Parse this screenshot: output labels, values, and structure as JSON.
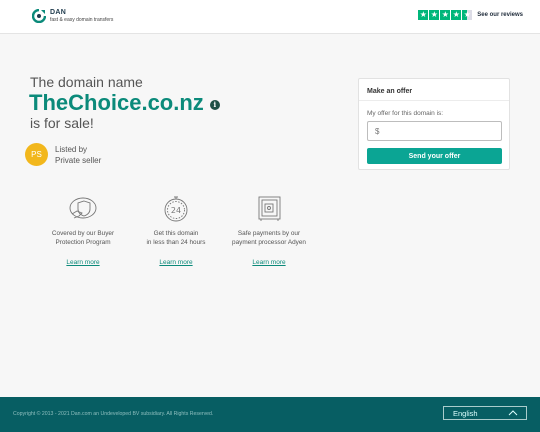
{
  "header": {
    "brand_name": "DAN",
    "brand_tagline": "fast & easy domain transfers",
    "reviews_link": "See our reviews",
    "rating_stars": 4.5,
    "brand_color": "#0b8a7a"
  },
  "main": {
    "lead": "The domain name",
    "domain": "TheChoice.co.nz",
    "forsale": "is for sale!",
    "seller": {
      "initials": "PS",
      "listed_by": "Listed by",
      "name": "Private seller"
    },
    "features": [
      {
        "icon": "shield-hand-icon",
        "line1": "Covered by our Buyer",
        "line2": "Protection Program",
        "link": "Learn more"
      },
      {
        "icon": "clock-24-icon",
        "line1": "Get this domain",
        "line2": "in less than 24 hours",
        "link": "Learn more"
      },
      {
        "icon": "safe-icon",
        "line1": "Safe payments by our",
        "line2": "payment processor Adyen",
        "link": "Learn more"
      }
    ]
  },
  "offer": {
    "title": "Make an offer",
    "label": "My offer for this domain is:",
    "placeholder": "$",
    "button": "Send your offer"
  },
  "footer": {
    "copyright": "Copyright © 2013 - 2021 Dan.com an Undeveloped BV subsidiary. All Rights Reserved.",
    "language": "English"
  }
}
